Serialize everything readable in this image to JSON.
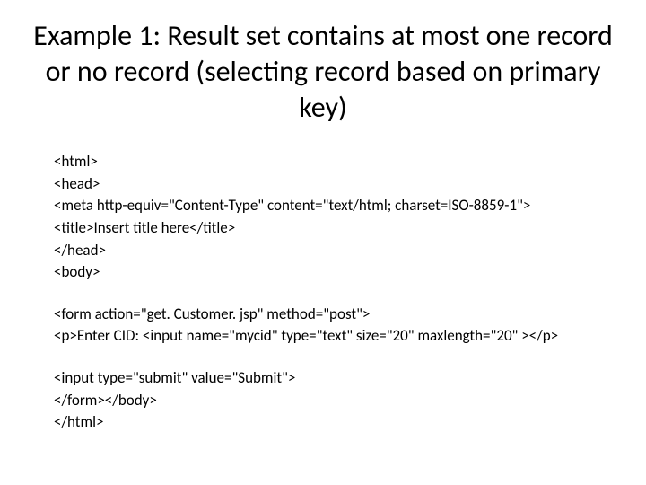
{
  "title": "Example 1: Result set contains at most one record or no record (selecting record based on primary key)",
  "code_lines": [
    "<html>",
    "<head>",
    "<meta http-equiv=\"Content-Type\" content=\"text/html; charset=ISO-8859-1\">",
    "<title>Insert title here</title>",
    "</head>",
    "<body>",
    "",
    "<form action=\"get. Customer. jsp\" method=\"post\">",
    "<p>Enter CID: <input name=\"mycid\" type=\"text\" size=\"20\" maxlength=\"20\" ></p>",
    "",
    "<input type=\"submit\" value=\"Submit\">",
    "</form></body>",
    "</html>"
  ]
}
